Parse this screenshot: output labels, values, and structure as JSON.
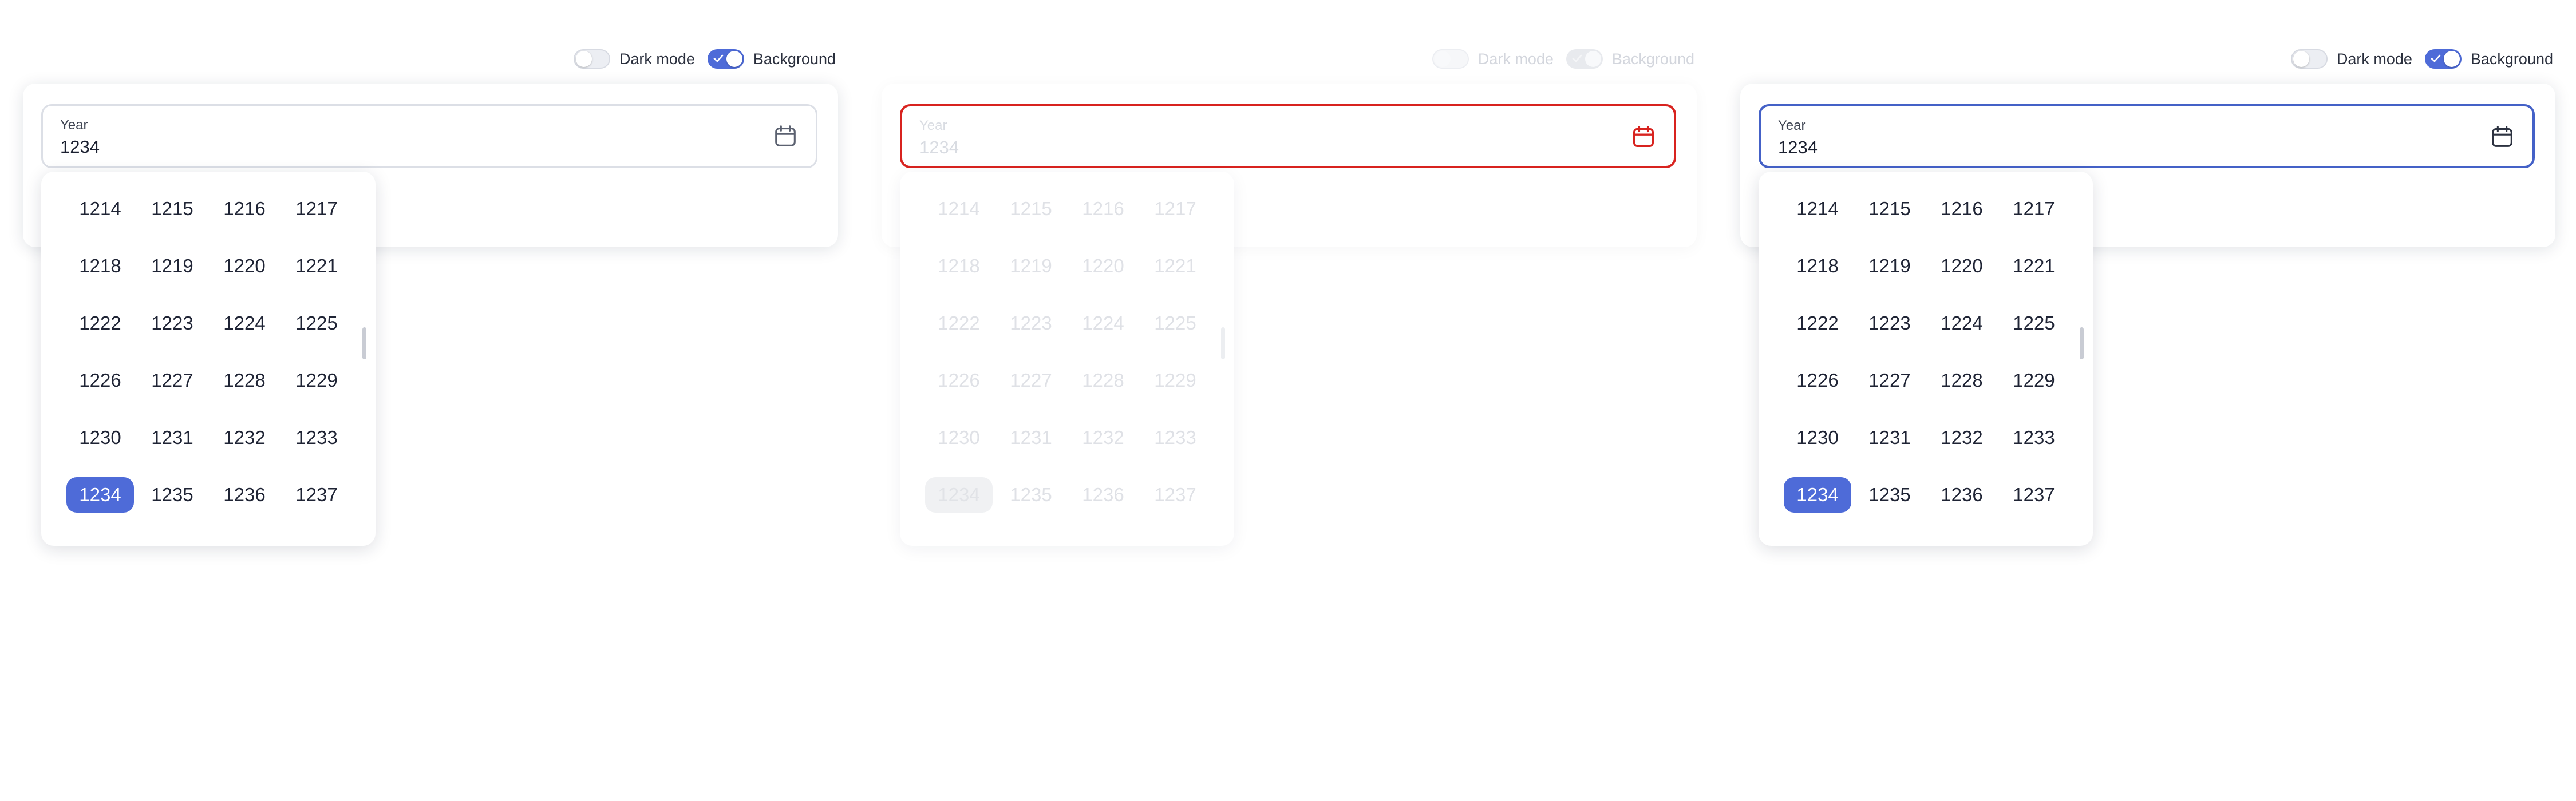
{
  "panels": [
    {
      "state": "default",
      "dark_mode": {
        "label": "Dark mode",
        "on": false
      },
      "background": {
        "label": "Background",
        "on": true
      },
      "field": {
        "label": "Year",
        "value": "1234"
      },
      "selected_year": "1234"
    },
    {
      "state": "disabled-error",
      "dark_mode": {
        "label": "Dark mode",
        "on": false
      },
      "background": {
        "label": "Background",
        "on": true
      },
      "field": {
        "label": "Year",
        "value": "1234"
      },
      "selected_year": "1234"
    },
    {
      "state": "focused",
      "dark_mode": {
        "label": "Dark mode",
        "on": false
      },
      "background": {
        "label": "Background",
        "on": true
      },
      "field": {
        "label": "Year",
        "value": "1234"
      },
      "selected_year": "1234"
    }
  ],
  "years": [
    "1214",
    "1215",
    "1216",
    "1217",
    "1218",
    "1219",
    "1220",
    "1221",
    "1222",
    "1223",
    "1224",
    "1225",
    "1226",
    "1227",
    "1228",
    "1229",
    "1230",
    "1231",
    "1232",
    "1233",
    "1234",
    "1235",
    "1236",
    "1237"
  ],
  "icons": {
    "calendar": "calendar-icon",
    "check": "check-icon"
  },
  "colors": {
    "accent": "#4e6bd8",
    "focus_border": "#4461c7",
    "error_border": "#d8231f",
    "text": "#1f2435"
  }
}
